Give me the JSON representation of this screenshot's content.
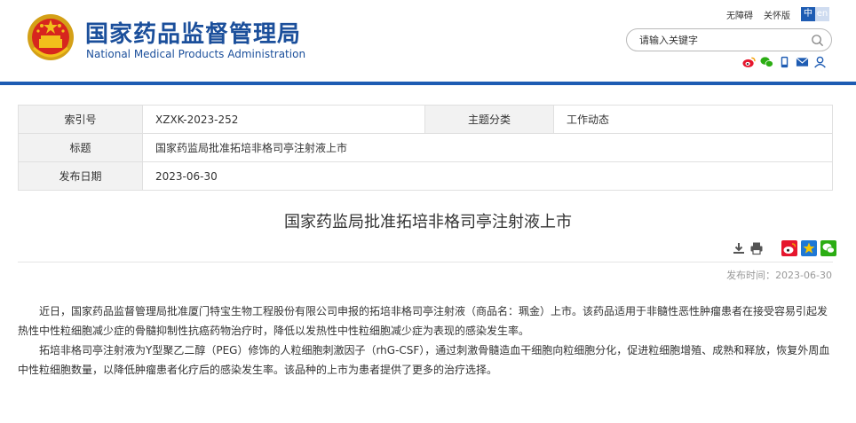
{
  "header": {
    "title_cn": "国家药品监督管理局",
    "title_en": "National Medical Products Administration",
    "accessibility_label": "无障碍",
    "care_mode_label": "关怀版",
    "lang_cn": "中",
    "lang_en": "en",
    "search_placeholder": "请输入关键字"
  },
  "icons": {
    "emblem": "national-emblem-icon",
    "search": "search-icon",
    "weibo": "weibo-icon",
    "wechat": "wechat-icon",
    "mobile": "mobile-icon",
    "mail": "mail-icon",
    "user": "user-icon",
    "download": "download-icon",
    "print": "print-icon",
    "star": "star-icon"
  },
  "colors": {
    "brand_blue": "#1b4f9b",
    "accent_blue": "#1e5cb3",
    "weibo_red": "#e6162d",
    "wechat_green": "#2bad13"
  },
  "meta": {
    "index_label": "索引号",
    "index_value": "XZXK-2023-252",
    "category_label": "主题分类",
    "category_value": "工作动态",
    "title_label": "标题",
    "title_value": "国家药监局批准拓培非格司亭注射液上市",
    "date_label": "发布日期",
    "date_value": "2023-06-30"
  },
  "article": {
    "title": "国家药监局批准拓培非格司亭注射液上市",
    "publish_prefix": "发布时间：",
    "publish_date": "2023-06-30",
    "paragraphs": [
      "近日，国家药品监督管理局批准厦门特宝生物工程股份有限公司申报的拓培非格司亭注射液（商品名：珮金）上市。该药品适用于非髓性恶性肿瘤患者在接受容易引起发热性中性粒细胞减少症的骨髓抑制性抗癌药物治疗时，降低以发热性中性粒细胞减少症为表现的感染发生率。",
      "拓培非格司亭注射液为Y型聚乙二醇（PEG）修饰的人粒细胞刺激因子（rhG-CSF），通过刺激骨髓造血干细胞向粒细胞分化，促进粒细胞增殖、成熟和释放，恢复外周血中性粒细胞数量，以降低肿瘤患者化疗后的感染发生率。该品种的上市为患者提供了更多的治疗选择。"
    ]
  }
}
